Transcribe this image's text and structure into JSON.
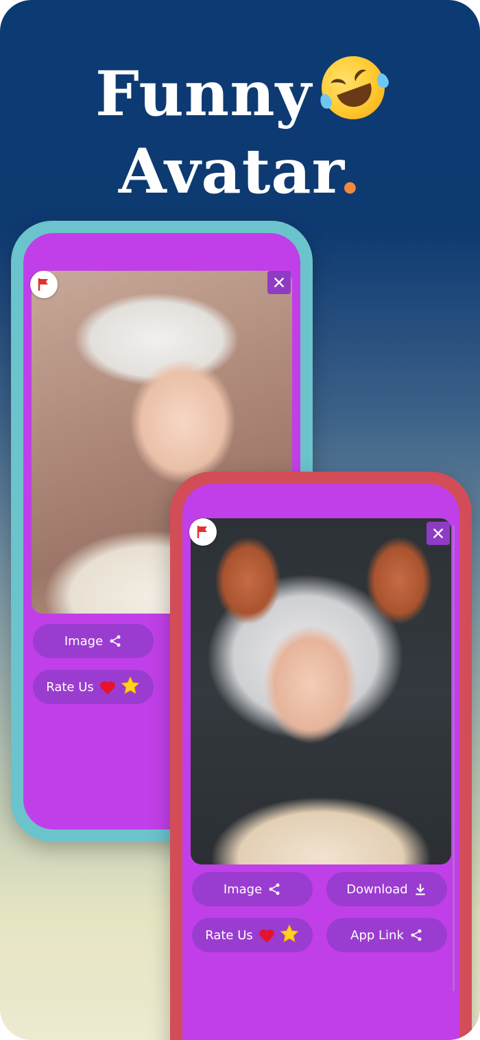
{
  "headline": {
    "line1": "Funny",
    "line2": "Avatar",
    "line2_dot": ".",
    "emoji": "rolling-on-floor-laughing-icon"
  },
  "colors": {
    "background_top": "#0c3a73",
    "background_bottom": "#ecead0",
    "screen": "#c13fe8",
    "pill": "#9b3cd0",
    "phone_back": "#6bc3cc",
    "phone_front": "#d24d57",
    "accent_dot": "#f08a3c"
  },
  "back_phone": {
    "buttons": {
      "image": "Image",
      "rate_us": "Rate Us"
    },
    "icons": [
      "flag-icon",
      "close-icon",
      "share-icon",
      "heart-icon",
      "star-icon"
    ]
  },
  "front_phone": {
    "buttons": {
      "image": "Image",
      "download": "Download",
      "rate_us": "Rate Us",
      "app_link": "App Link"
    },
    "icons": [
      "flag-icon",
      "close-icon",
      "share-icon",
      "download-icon",
      "heart-icon",
      "star-icon"
    ]
  }
}
